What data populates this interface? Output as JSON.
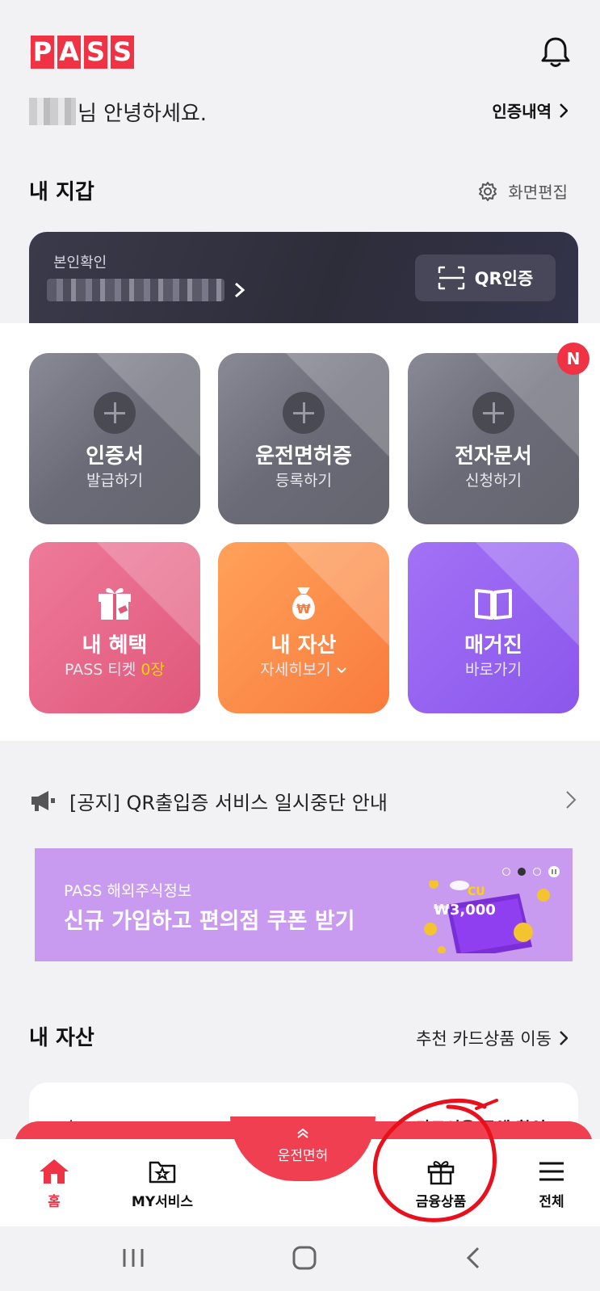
{
  "app": {
    "logo_letters": [
      "P",
      "A",
      "S",
      "S"
    ],
    "brand_color": "#ef3345"
  },
  "header": {
    "greeting": "님 안녕하세요.",
    "auth_history": "인증내역"
  },
  "wallet": {
    "title": "내 지갑",
    "edit_label": "화면편집",
    "id_card": {
      "label": "본인확인",
      "qr_label": "QR인증"
    }
  },
  "tiles": [
    {
      "title": "인증서",
      "sub": "발급하기",
      "icon": "plus-icon"
    },
    {
      "title": "운전면허증",
      "sub": "등록하기",
      "icon": "plus-icon"
    },
    {
      "title": "전자문서",
      "sub": "신청하기",
      "icon": "plus-icon",
      "badge": "N"
    },
    {
      "title": "내 혜택",
      "sub_prefix": "PASS 티켓 ",
      "sub_highlight": "0장",
      "icon": "gift-icon"
    },
    {
      "title": "내 자산",
      "sub": "자세히보기",
      "icon": "money-bag-icon"
    },
    {
      "title": "매거진",
      "sub": "바로가기",
      "icon": "book-icon"
    }
  ],
  "notice": {
    "text": "[공지] QR출입증 서비스 일시중단 안내"
  },
  "banner": {
    "sub": "PASS 해외주식정보",
    "title": "신규 가입하고 편의점 쿠폰 받기",
    "coupon_brand": "CU",
    "coupon_value": "₩3,000"
  },
  "assets": {
    "title": "내 자산",
    "link": "추천 카드상품 이동",
    "card_left": "카드",
    "card_right": "카드이용 금액 확인"
  },
  "bottom_nav": {
    "home": "홈",
    "my_service": "MY서비스",
    "center": "운전면허",
    "finance": "금융상품",
    "all": "전체"
  }
}
